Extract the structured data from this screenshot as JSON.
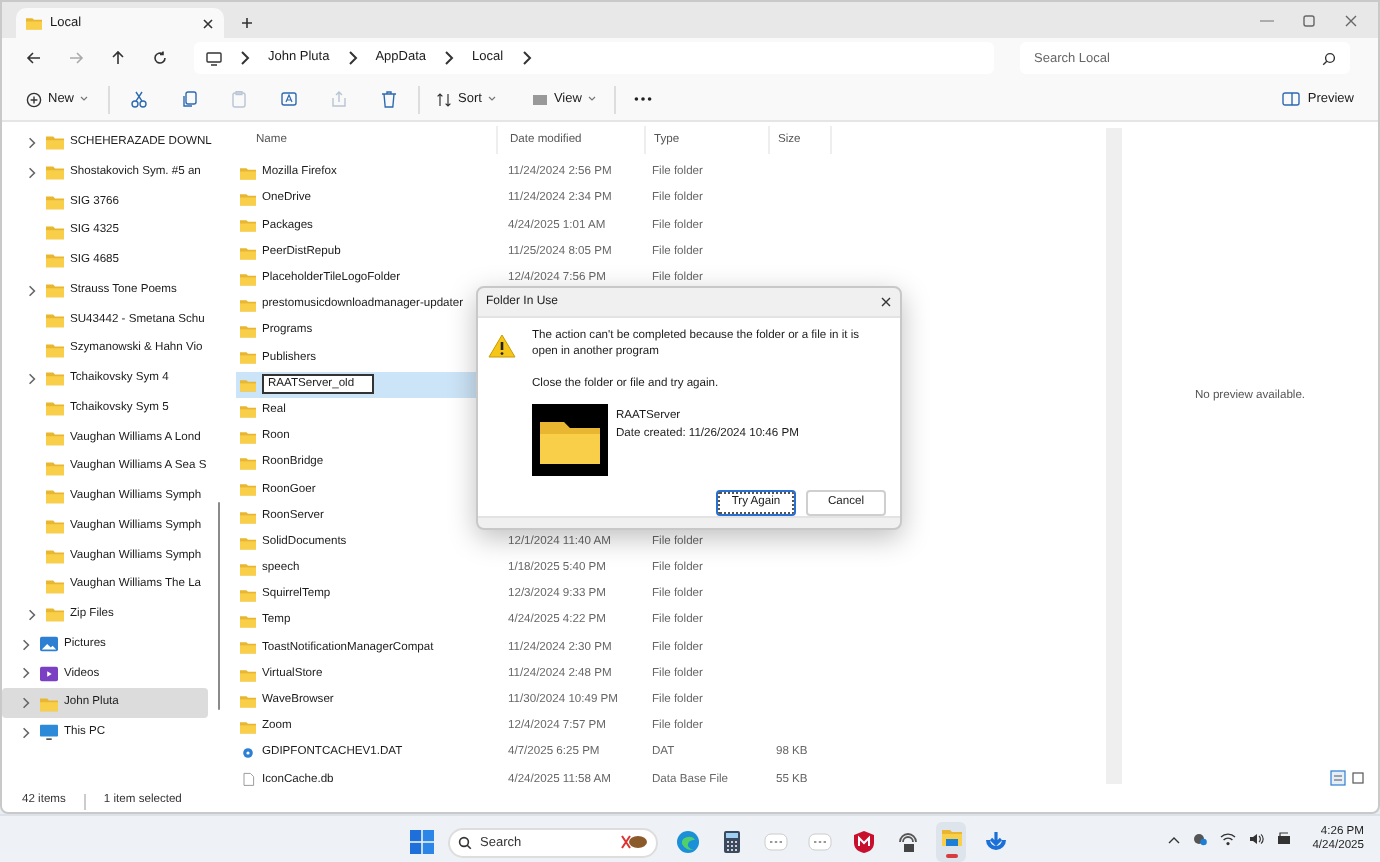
{
  "tab": {
    "title": "Local"
  },
  "address": {
    "crumbs": [
      "John Pluta",
      "AppData",
      "Local"
    ]
  },
  "search": {
    "placeholder": "Search Local"
  },
  "toolbar": {
    "new": "New",
    "sort": "Sort",
    "view": "View",
    "preview": "Preview",
    "tools": [
      {
        "kind": "cut",
        "disabled": false
      },
      {
        "kind": "copy",
        "disabled": false
      },
      {
        "kind": "paste",
        "disabled": true
      },
      {
        "kind": "rename",
        "disabled": false
      },
      {
        "kind": "share",
        "disabled": true
      },
      {
        "kind": "delete",
        "disabled": false
      }
    ]
  },
  "sidebar": {
    "items": [
      {
        "label": "SCHEHERAZADE DOWNL",
        "kind": "folder",
        "expandable": true,
        "selected": false
      },
      {
        "label": "Shostakovich Sym. #5 an",
        "kind": "folder",
        "expandable": true,
        "selected": false
      },
      {
        "label": "SIG 3766",
        "kind": "folder",
        "expandable": false,
        "selected": false
      },
      {
        "label": "SIG 4325",
        "kind": "folder",
        "expandable": false,
        "selected": false
      },
      {
        "label": "SIG 4685",
        "kind": "folder",
        "expandable": false,
        "selected": false
      },
      {
        "label": "Strauss Tone Poems",
        "kind": "folder",
        "expandable": true,
        "selected": false
      },
      {
        "label": "SU43442 - Smetana Schu",
        "kind": "folder",
        "expandable": false,
        "selected": false
      },
      {
        "label": "Szymanowski & Hahn Vio",
        "kind": "folder",
        "expandable": false,
        "selected": false
      },
      {
        "label": "Tchaikovsky Sym 4",
        "kind": "folder",
        "expandable": true,
        "selected": false
      },
      {
        "label": "Tchaikovsky Sym 5",
        "kind": "folder",
        "expandable": false,
        "selected": false
      },
      {
        "label": "Vaughan Williams A Lond",
        "kind": "folder",
        "expandable": false,
        "selected": false
      },
      {
        "label": "Vaughan Williams A Sea S",
        "kind": "folder",
        "expandable": false,
        "selected": false
      },
      {
        "label": "Vaughan Williams Symph",
        "kind": "folder",
        "expandable": false,
        "selected": false
      },
      {
        "label": "Vaughan Williams Symph",
        "kind": "folder",
        "expandable": false,
        "selected": false
      },
      {
        "label": "Vaughan Williams Symph",
        "kind": "folder",
        "expandable": false,
        "selected": false
      },
      {
        "label": "Vaughan Williams The La",
        "kind": "folder",
        "expandable": false,
        "selected": false
      },
      {
        "label": "Zip Files",
        "kind": "folder",
        "expandable": true,
        "selected": false
      },
      {
        "label": "Pictures",
        "kind": "pictures",
        "expandable": true,
        "selected": false
      },
      {
        "label": "Videos",
        "kind": "videos",
        "expandable": true,
        "selected": false
      },
      {
        "label": "John Pluta",
        "kind": "user",
        "expandable": true,
        "selected": true
      },
      {
        "label": "This PC",
        "kind": "pc",
        "expandable": true,
        "selected": false
      }
    ]
  },
  "columns": [
    "Name",
    "Date modified",
    "Type",
    "Size"
  ],
  "rows": [
    {
      "name": "Mozilla Firefox",
      "kind": "folder",
      "date": "11/24/2024 2:56 PM",
      "type": "File folder",
      "selected": false
    },
    {
      "name": "OneDrive",
      "kind": "folder",
      "date": "11/24/2024 2:34 PM",
      "type": "File folder",
      "selected": false
    },
    {
      "name": "Packages",
      "kind": "folder",
      "date": "4/24/2025 1:01 AM",
      "type": "File folder",
      "selected": false
    },
    {
      "name": "PeerDistRepub",
      "kind": "folder",
      "date": "11/25/2024 8:05 PM",
      "type": "File folder",
      "selected": false
    },
    {
      "name": "PlaceholderTileLogoFolder",
      "kind": "folder",
      "date": "12/4/2024 7:56 PM",
      "type": "File folder",
      "selected": false
    },
    {
      "name": "prestomusicdownloadmanager-updater",
      "kind": "folder",
      "selected": false
    },
    {
      "name": "Programs",
      "kind": "folder",
      "selected": false
    },
    {
      "name": "Publishers",
      "kind": "folder",
      "selected": false
    },
    {
      "name": "RAATServer_old",
      "kind": "folder",
      "selected": true,
      "renaming": true
    },
    {
      "name": "Real",
      "kind": "folder",
      "selected": false
    },
    {
      "name": "Roon",
      "kind": "folder",
      "selected": false
    },
    {
      "name": "RoonBridge",
      "kind": "folder",
      "selected": false
    },
    {
      "name": "RoonGoer",
      "kind": "folder",
      "selected": false
    },
    {
      "name": "RoonServer",
      "kind": "folder",
      "selected": false
    },
    {
      "name": "SolidDocuments",
      "kind": "folder",
      "date": "12/1/2024 11:40 AM",
      "type": "File folder",
      "selected": false
    },
    {
      "name": "speech",
      "kind": "folder",
      "date": "1/18/2025 5:40 PM",
      "type": "File folder",
      "selected": false
    },
    {
      "name": "SquirrelTemp",
      "kind": "folder",
      "date": "12/3/2024 9:33 PM",
      "type": "File folder",
      "selected": false
    },
    {
      "name": "Temp",
      "kind": "folder",
      "date": "4/24/2025 4:22 PM",
      "type": "File folder",
      "selected": false
    },
    {
      "name": "ToastNotificationManagerCompat",
      "kind": "folder",
      "date": "11/24/2024 2:30 PM",
      "type": "File folder",
      "selected": false
    },
    {
      "name": "VirtualStore",
      "kind": "folder",
      "date": "11/24/2024 2:48 PM",
      "type": "File folder",
      "selected": false
    },
    {
      "name": "WaveBrowser",
      "kind": "folder",
      "date": "11/30/2024 10:49 PM",
      "type": "File folder",
      "selected": false
    },
    {
      "name": "Zoom",
      "kind": "folder",
      "date": "12/4/2024 7:57 PM",
      "type": "File folder",
      "selected": false
    },
    {
      "name": "GDIPFONTCACHEV1.DAT",
      "kind": "dat",
      "date": "4/7/2025 6:25 PM",
      "type": "DAT",
      "size": "98 KB",
      "selected": false
    },
    {
      "name": "IconCache.db",
      "kind": "db",
      "date": "4/24/2025 11:58 AM",
      "type": "Data Base File",
      "size": "55 KB",
      "selected": false
    }
  ],
  "preview": {
    "message": "No preview available."
  },
  "status_bar": {
    "count": "42 items",
    "selection": "1 item selected"
  },
  "dialog": {
    "title": "Folder In Use",
    "message": "The action can't be completed because the folder or a file in it is open in another program",
    "hint": "Close the folder or file and try again.",
    "item_name": "RAATServer",
    "item_date": "Date created: 11/26/2024 10:46 PM",
    "buttons": [
      {
        "label": "Try Again",
        "focused": true
      },
      {
        "label": "Cancel",
        "focused": false
      }
    ]
  },
  "taskbar": {
    "search": {
      "placeholder": "Search"
    },
    "apps": [
      {
        "kind": "edge",
        "active": false
      },
      {
        "kind": "calculator",
        "active": false
      },
      {
        "kind": "app",
        "active": false
      },
      {
        "kind": "app",
        "active": false
      },
      {
        "kind": "shield",
        "active": false
      },
      {
        "kind": "network",
        "active": false
      },
      {
        "kind": "explorer",
        "active": true
      },
      {
        "kind": "download",
        "active": false
      }
    ],
    "time": "4:26 PM",
    "date": "4/24/2025"
  }
}
